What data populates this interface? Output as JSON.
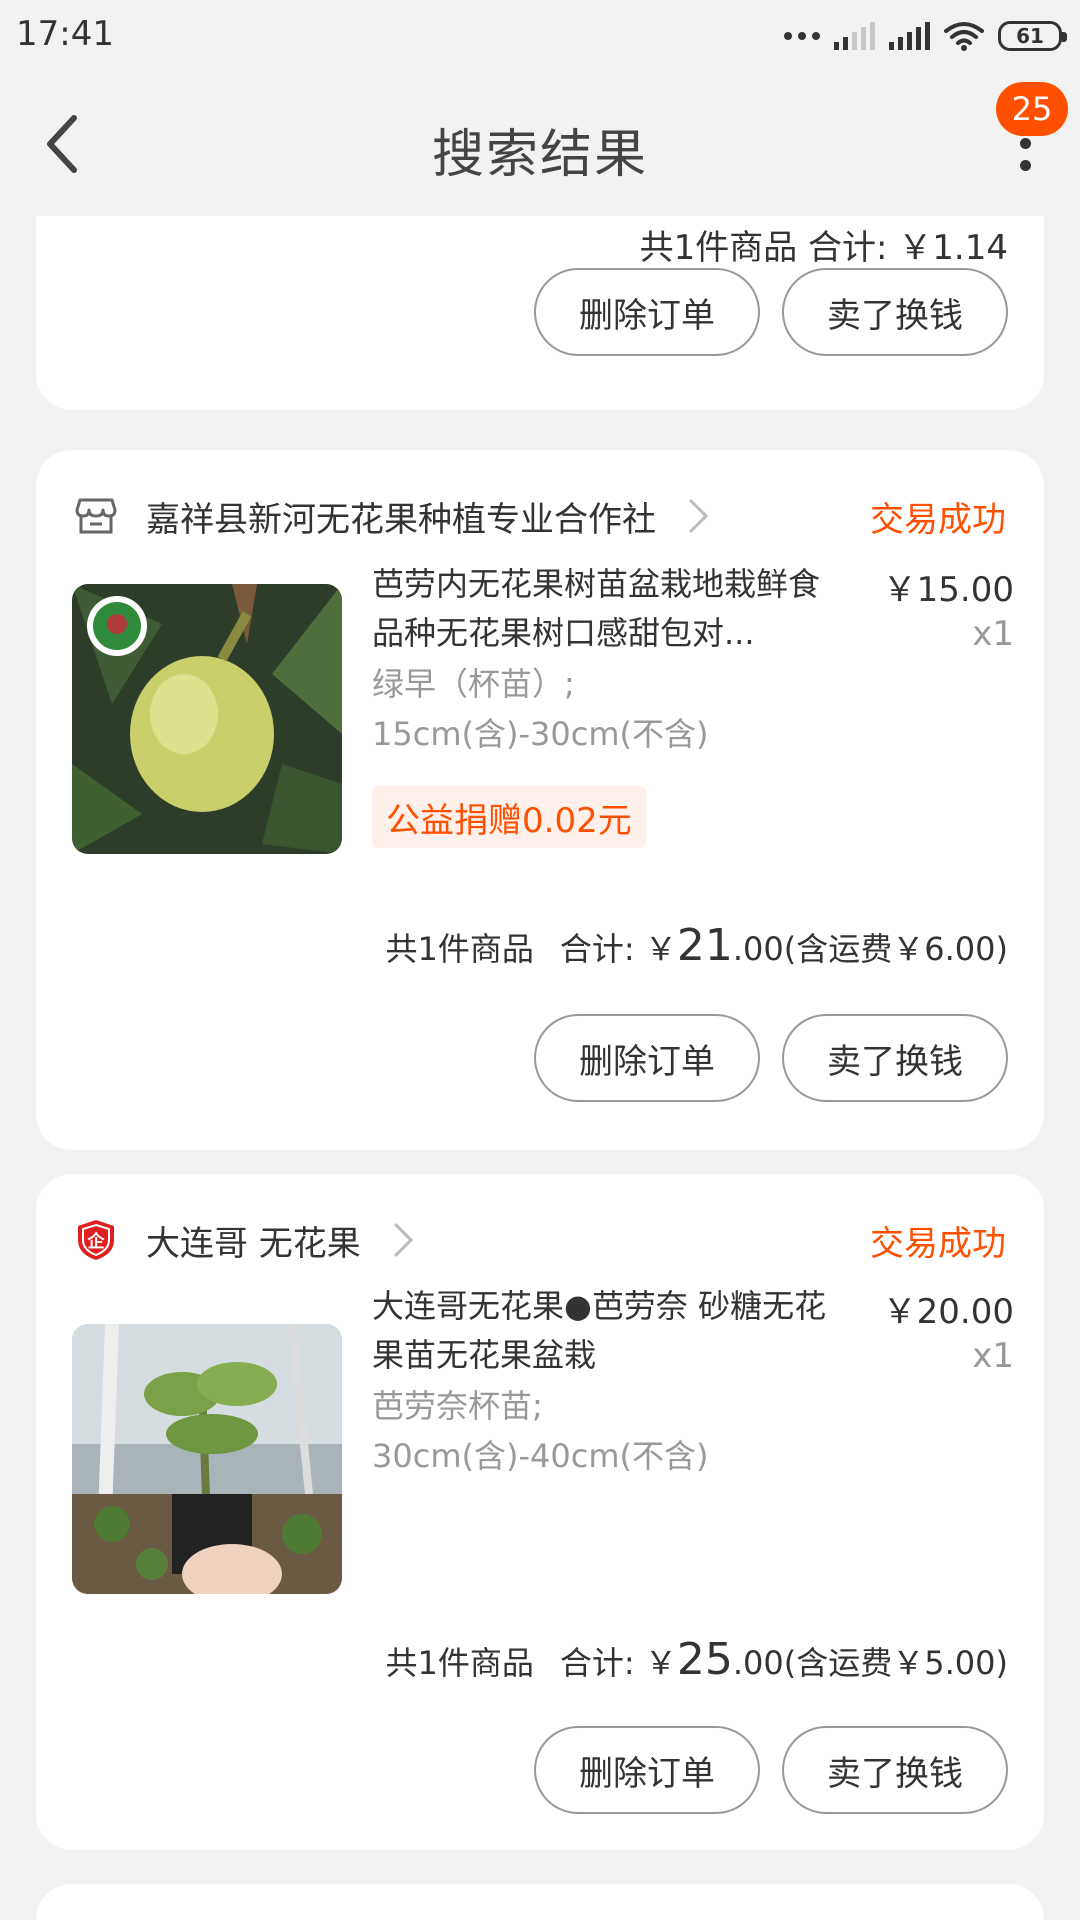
{
  "status_bar": {
    "time": "17:41",
    "battery": "61"
  },
  "nav": {
    "title": "搜索结果",
    "badge": "25"
  },
  "card_top": {
    "summary": "共1件商品  合计: ￥1.14",
    "delete_label": "删除订单",
    "sell_label": "卖了换钱"
  },
  "orders": [
    {
      "shop_name": "嘉祥县新河无花果种植专业合作社",
      "status": "交易成功",
      "title": "芭劳内无花果树苗盆栽地栽鲜食品种无花果树口感甜包对...",
      "sku_line1": "绿早（杯苗）;",
      "sku_line2": "15cm(含)-30cm(不含)",
      "price": "￥15.00",
      "qty": "x1",
      "charity": "公益捐赠0.02元",
      "count": "共1件商品",
      "total_label": "合计: ￥",
      "total_int": "21",
      "total_dec": ".00",
      "shipping": " (含运费￥6.00)",
      "delete_label": "删除订单",
      "sell_label": "卖了换钱"
    },
    {
      "shop_name": "大连哥 无花果",
      "status": "交易成功",
      "title": "大连哥无花果●芭劳奈 砂糖无花果苗无花果盆栽",
      "sku_line1": "芭劳奈杯苗;",
      "sku_line2": "30cm(含)-40cm(不含)",
      "price": "￥20.00",
      "qty": "x1",
      "count": "共1件商品",
      "total_label": "合计: ￥",
      "total_int": "25",
      "total_dec": ".00",
      "shipping": " (含运费￥5.00)",
      "delete_label": "删除订单",
      "sell_label": "卖了换钱"
    }
  ],
  "colors": {
    "accent": "#ff5000",
    "background": "#f2f2f2",
    "card": "#ffffff"
  }
}
